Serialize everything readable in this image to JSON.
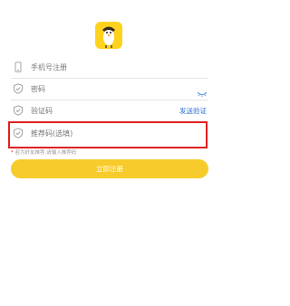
{
  "app": {
    "logo_icon": "duck-mascot-logo-icon"
  },
  "form": {
    "phone": {
      "icon": "phone-icon",
      "placeholder": "手机号注册"
    },
    "password": {
      "icon": "shield-check-icon",
      "placeholder": "密码",
      "toggle_icon": "eye-closed-icon"
    },
    "verify_code": {
      "icon": "shield-check-icon",
      "placeholder": "验证码",
      "send_label": "发送验证"
    },
    "referral": {
      "icon": "shield-check-icon",
      "placeholder": "推荐码(选填)"
    },
    "hint": {
      "star": "*",
      "text": "若为好友推荐,请输入推荐码"
    },
    "submit_label": "立即注册"
  },
  "colors": {
    "accent": "#f7cb2c",
    "link": "#2a6fd6",
    "highlight": "#e02020"
  }
}
